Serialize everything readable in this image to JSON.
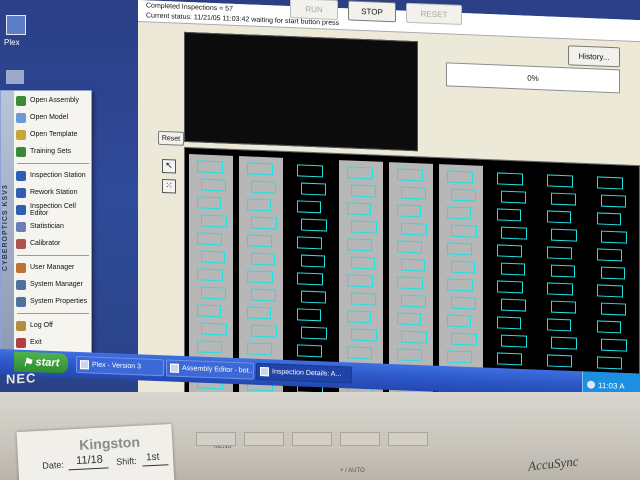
{
  "desktop": {
    "icon_label": "Plex"
  },
  "app": {
    "status_completed": "Completed Inspections = 57",
    "status_current": "Current status: 11/21/05 11:03:42  waiting for start button press",
    "buttons": {
      "run": "RUN",
      "stop": "STOP",
      "reset": "RESET",
      "history": "History...",
      "reset_view": "Reset"
    },
    "progress_text": "0%",
    "progress_value": 0,
    "inspection_image": {
      "columns": 9
    }
  },
  "start_menu": {
    "brand": "CYBEROPTICS  KSV3",
    "groups": [
      [
        "Open Assembly",
        "Open Model",
        "Open Template",
        "Training Sets"
      ],
      [
        "Inspection Station",
        "Rework Station",
        "Inspection Cell Editor",
        "Statistician",
        "Calibrator"
      ],
      [
        "User Manager",
        "System Manager",
        "System Properties"
      ],
      [
        "Log Off",
        "Exit"
      ]
    ],
    "icon_colors": [
      "#3a8a3a",
      "#6a9ad8",
      "#c9a43a",
      "#3a8a3a",
      "#2f5fb0",
      "#2f5fb0",
      "#2f5fb0",
      "#6a7fb8",
      "#b05050",
      "#c07030",
      "#5070a0",
      "#5070a0",
      "#b09040",
      "#b04040"
    ]
  },
  "taskbar": {
    "start_label": "start",
    "tasks": [
      {
        "label": "Plex - Version 3",
        "active": false
      },
      {
        "label": "Assembly Editor - bot...",
        "active": false
      },
      {
        "label": "Inspection Details: A...",
        "active": true
      }
    ],
    "clock": "11:03 A"
  },
  "monitor": {
    "brand": "NEC",
    "model": "AccuSync",
    "menu_label": "MENU",
    "adjust_label": "+ / AUTO"
  },
  "note": {
    "brand": "Kingston",
    "date_label": "Date:",
    "date_value": "11/18",
    "shift_label": "Shift:",
    "shift_value": "1st"
  },
  "colors": {
    "cyan": "#22e0e0",
    "taskbar_blue": "#2d58c8",
    "start_green": "#3aa33a"
  }
}
